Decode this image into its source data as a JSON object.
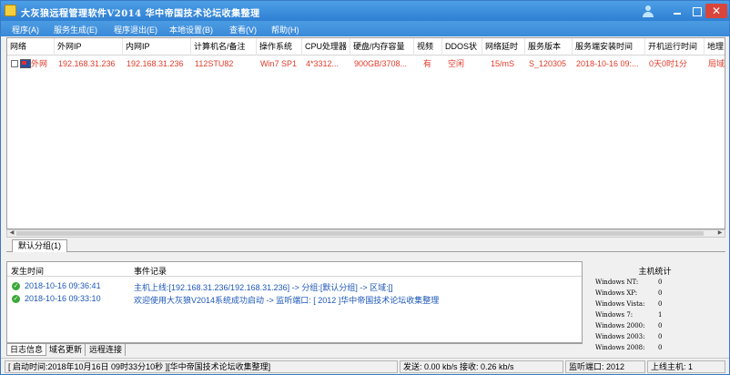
{
  "window": {
    "title": "大灰狼远程管理软件V2014   华中帝国技术论坛收集整理",
    "close_glyph": "✕"
  },
  "menu": [
    "程序(A)",
    "服务生成(E)",
    "程序退出(E)",
    "本地设置(B)",
    "查看(V)",
    "帮助(H)"
  ],
  "hosts_table": {
    "columns": [
      "网络",
      "外网IP",
      "内网IP",
      "计算机名/备注",
      "操作系统",
      "CPU处理器",
      "硬盘/内存容量",
      "视频",
      "DDOS状",
      "网络延时",
      "服务版本",
      "服务端安装时间",
      "开机运行时间",
      "地理"
    ],
    "rows": [
      [
        "外网",
        "192.168.31.236",
        "192.168.31.236",
        "112STU82",
        "Win7 SP1",
        "4*3312...",
        "900GB/3708...",
        "有",
        "空闲",
        "15/mS",
        "S_120305",
        "2018-10-16 09:...",
        "0天0时1分",
        "局域"
      ]
    ]
  },
  "group_tab": "默认分组(1)",
  "log": {
    "columns": [
      "发生时间",
      "事件记录"
    ],
    "rows": [
      {
        "time": "2018-10-16 09:36:41",
        "event": "主机上线:[192.168.31.236/192.168.31.236] -> 分组:[默认分组] -> 区域:[]"
      },
      {
        "time": "2018-10-16 09:33:10",
        "event": "欢迎使用大灰狼V2014系统成功启动 -> 监听端口: [ 2012 ]华中帝国技术论坛收集整理"
      }
    ]
  },
  "stats": {
    "title": "主机统计",
    "items": [
      {
        "label": "Windows NT:",
        "value": "0"
      },
      {
        "label": "Windows XP:",
        "value": "0"
      },
      {
        "label": "Windows Vista:",
        "value": "0"
      },
      {
        "label": "Windows 7:",
        "value": "1"
      },
      {
        "label": "Windows 2000:",
        "value": "0"
      },
      {
        "label": "Windows 2003:",
        "value": "0"
      },
      {
        "label": "Windows 2008:",
        "value": "0"
      }
    ]
  },
  "bottom_tabs": [
    "日志信息",
    "域名更新",
    "远程连接"
  ],
  "status": {
    "start_time": "[ 启动时间:2018年10月16日 09时33分10秒 ][华中帝国技术论坛收集整理]",
    "traffic": "发送: 0.00 kb/s 接收: 0.26 kb/s",
    "port": "监听端口: 2012",
    "online": "上线主机: 1"
  }
}
